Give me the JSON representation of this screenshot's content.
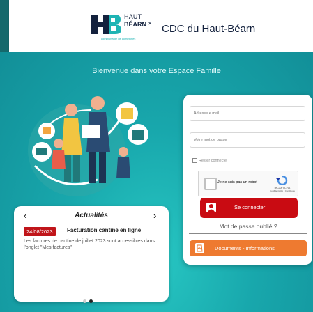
{
  "header": {
    "logo": {
      "line1": "HAUT",
      "line2": "BÉARN",
      "mark": "×",
      "subtitle": "communauté de communes"
    },
    "title": "CDC du Haut-Béarn"
  },
  "welcome": "Bienvenue dans votre Espace Famille",
  "login": {
    "email_placeholder": "Adresse e mail",
    "password_placeholder": "Votre mot de passe",
    "remember_label": "Rester connecté",
    "captcha_label": "Je ne suis pas un robot",
    "captcha_brand": "reCAPTCHA",
    "captcha_links": "Confidentialité - Conditions",
    "submit_label": "Se connecter",
    "forgot_label": "Mot de passe oublié ?",
    "docs_label": "Documents - Informations"
  },
  "news": {
    "title": "Actualités",
    "prev": "‹",
    "next": "›",
    "date": "24/08/2023",
    "headline": "Facturation cantine en ligne",
    "body": "Les factures de cantine de juillet 2023 sont accessibles dans l'onglet \"Mes factures\""
  },
  "colors": {
    "accent": "#1fb4b4",
    "primary_button": "#c90b12",
    "secondary_button": "#ee7a30",
    "date_badge": "#c0151a",
    "text_dark": "#13213d"
  }
}
